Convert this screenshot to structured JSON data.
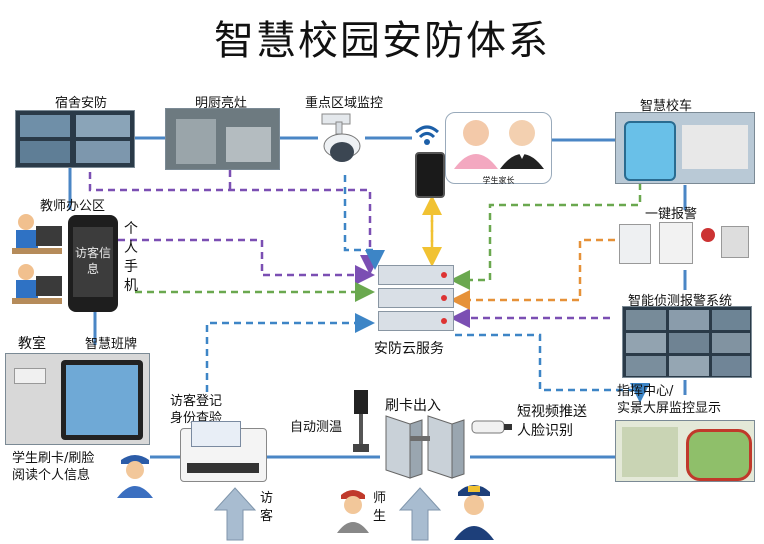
{
  "title": "智慧校园安防体系",
  "nodes": {
    "dorm": "宿舍安防",
    "kitchen": "明厨亮灶",
    "key_area": "重点区域监控",
    "bus": "智慧校车",
    "teacher_office": "教师办公区",
    "phone_text": "访客信息",
    "personal_phone": "个人手机",
    "one_key_alarm": "一键报警",
    "detection": "智能侦测报警系统",
    "cloud": "安防云服务",
    "classroom": "教室",
    "smart_board": "智慧班牌",
    "visitor_check": "访客登记\n身份查验",
    "auto_temp": "自动测温",
    "card_access": "刷卡出入",
    "short_video": "短视频推送\n人脸识别",
    "command_center": "指挥中心/\n实景大屏监控显示",
    "student_card": "学生刷卡/刷脸\n阅读个人信息",
    "visitor": "访客",
    "teacher_student": "师生",
    "parents": "学生家长"
  },
  "colors": {
    "solid_line": "#4a86c5",
    "purple_dash": "#7b4fb3",
    "green_dash": "#6aa84f",
    "orange_dash": "#e69138",
    "blue_dash": "#3d85c6",
    "yellow_dash": "#f1c232",
    "server": "#d9dfe6",
    "arrow_fill": "#a8bcd0"
  }
}
